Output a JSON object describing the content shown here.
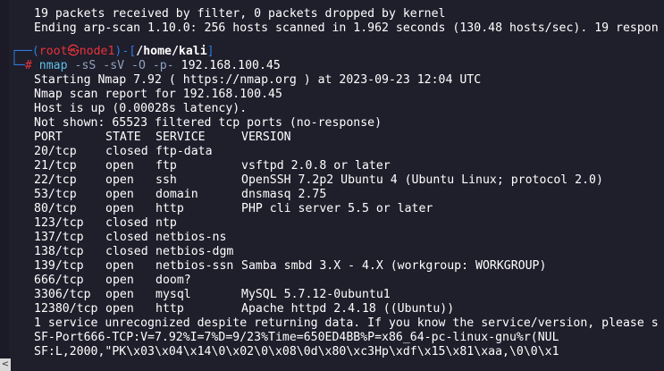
{
  "terminal": {
    "arp_lines": [
      "19 packets received by filter, 0 packets dropped by kernel",
      "Ending arp-scan 1.10.0: 256 hosts scanned in 1.962 seconds (130.48 hosts/sec). 19 respon"
    ],
    "prompt": {
      "corner_top": "┌──(",
      "user": "root",
      "at": "㉿",
      "host": "node1",
      "mid": ")-[",
      "path": "/home/kali",
      "end": "]",
      "corner_bottom": "└─",
      "hash": "#",
      "cmd": "nmap",
      "args": "-sS -sV -O -p-",
      "target": "192.168.100.45"
    },
    "output_head": [
      "Starting Nmap 7.92 ( https://nmap.org ) at 2023-09-23 12:04 UTC",
      "Nmap scan report for 192.168.100.45",
      "Host is up (0.00028s latency).",
      "Not shown: 65523 filtered tcp ports (no-response)"
    ],
    "table_header": {
      "port": "PORT",
      "state": "STATE",
      "service": "SERVICE",
      "version": "VERSION"
    },
    "ports": [
      {
        "port": "20/tcp",
        "state": "closed",
        "service": "ftp-data",
        "version": ""
      },
      {
        "port": "21/tcp",
        "state": "open",
        "service": "ftp",
        "version": "vsftpd 2.0.8 or later"
      },
      {
        "port": "22/tcp",
        "state": "open",
        "service": "ssh",
        "version": "OpenSSH 7.2p2 Ubuntu 4 (Ubuntu Linux; protocol 2.0)"
      },
      {
        "port": "53/tcp",
        "state": "open",
        "service": "domain",
        "version": "dnsmasq 2.75"
      },
      {
        "port": "80/tcp",
        "state": "open",
        "service": "http",
        "version": "PHP cli server 5.5 or later"
      },
      {
        "port": "123/tcp",
        "state": "closed",
        "service": "ntp",
        "version": ""
      },
      {
        "port": "137/tcp",
        "state": "closed",
        "service": "netbios-ns",
        "version": ""
      },
      {
        "port": "138/tcp",
        "state": "closed",
        "service": "netbios-dgm",
        "version": ""
      },
      {
        "port": "139/tcp",
        "state": "open",
        "service": "netbios-ssn",
        "version": "Samba smbd 3.X - 4.X (workgroup: WORKGROUP)"
      },
      {
        "port": "666/tcp",
        "state": "open",
        "service": "doom?",
        "version": ""
      },
      {
        "port": "3306/tcp",
        "state": "open",
        "service": "mysql",
        "version": "MySQL 5.7.12-0ubuntu1"
      },
      {
        "port": "12380/tcp",
        "state": "open",
        "service": "http",
        "version": "Apache httpd 2.4.18 ((Ubuntu))"
      }
    ],
    "output_tail": [
      "1 service unrecognized despite returning data. If you know the service/version, please s",
      "SF-Port666-TCP:V=7.92%I=7%D=9/23%Time=650ED4BB%P=x86_64-pc-linux-gnu%r(NUL",
      "SF:L,2000,\"PK\\x03\\x04\\x14\\0\\x02\\0\\x08\\0d\\x80\\xc3Hp\\xdf\\x15\\x81\\xaa,\\0\\0\\x1"
    ],
    "scroll_arrow": "<"
  }
}
